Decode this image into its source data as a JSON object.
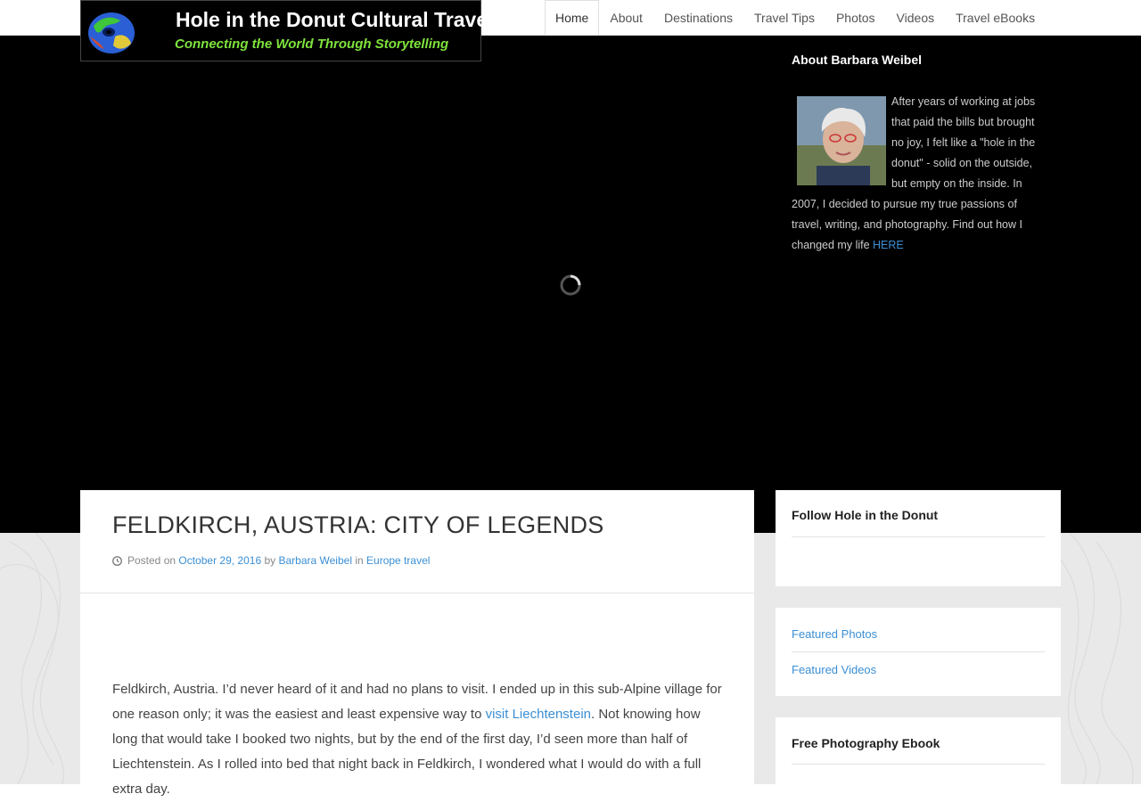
{
  "nav": {
    "items": [
      {
        "label": "Home",
        "active": true
      },
      {
        "label": "About",
        "active": false
      },
      {
        "label": "Destinations",
        "active": false
      },
      {
        "label": "Travel Tips",
        "active": false
      },
      {
        "label": "Photos",
        "active": false
      },
      {
        "label": "Videos",
        "active": false
      },
      {
        "label": "Travel eBooks",
        "active": false
      }
    ]
  },
  "logo": {
    "title": "Hole in the Donut Cultural Travel",
    "tagline": "Connecting the World Through Storytelling",
    "icon": "globe-donut-icon"
  },
  "hero": {
    "state": "loading",
    "icon": "loading-spinner-icon"
  },
  "about": {
    "title": "About Barbara Weibel",
    "text": "After years of working at jobs that paid the bills but brought no joy, I felt like a \"hole in the donut\" - solid on the outside, but empty on the inside. In 2007, I decided to pursue my true passions of travel, writing, and photography. Find out how I changed my life ",
    "link_label": "HERE"
  },
  "post": {
    "title": "FELDKIRCH, AUSTRIA: CITY OF LEGENDS",
    "posted_on_label": "Posted on",
    "date": "October 29, 2016",
    "by_label": "by",
    "author": "Barbara Weibel",
    "in_label": "in",
    "category": "Europe travel",
    "body_start": "Feldkirch, Austria. I’d never heard of it and had no plans to visit. I ended up in this sub-Alpine village for one reason only; it was the easiest and least expensive way to ",
    "body_link": "visit Liechtenstein",
    "body_rest": ". Not knowing how long that would take I booked two nights, but by the end of the first day, I’d seen more than half of Liechtenstein. As I rolled into bed that night back in Feldkirch, I wondered what I would do with a full extra day."
  },
  "widgets": {
    "follow": {
      "title": "Follow Hole in the Donut"
    },
    "featured": {
      "links": [
        "Featured Photos",
        "Featured Videos"
      ]
    },
    "ebook": {
      "title": "Free Photography Ebook"
    }
  },
  "colors": {
    "link": "#3b8fd4",
    "hero_bg": "#000000",
    "page_bg": "#e9e9e9",
    "logo_tagline": "#7fe33c"
  }
}
